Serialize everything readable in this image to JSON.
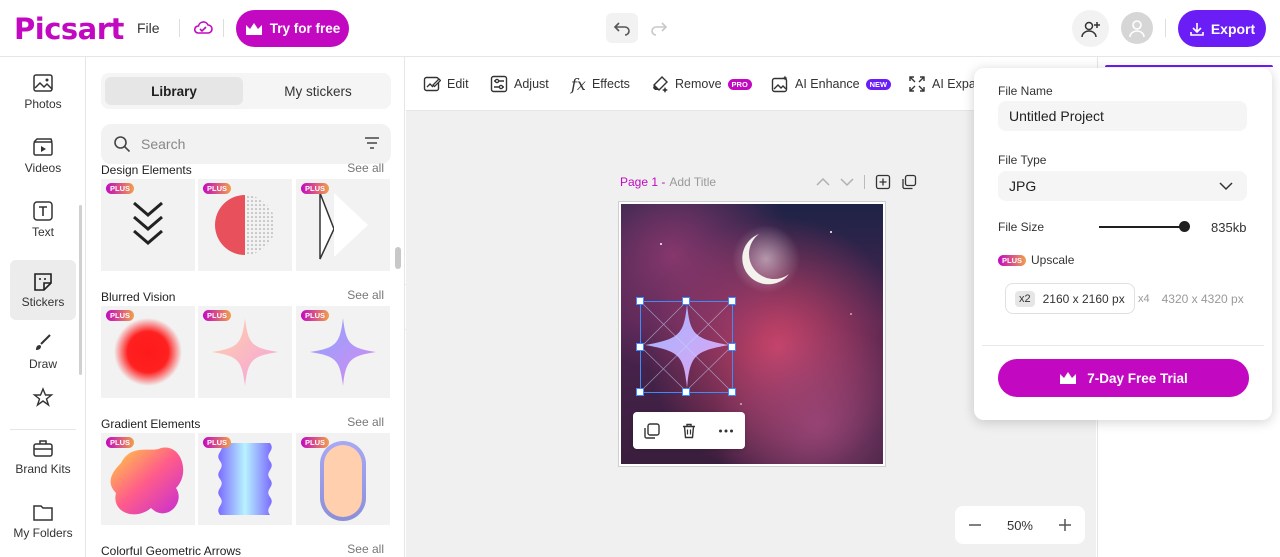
{
  "header": {
    "logo": "Picsart",
    "file_menu": "File",
    "try_label": "Try for free",
    "export_label": "Export"
  },
  "leftnav": {
    "items": [
      {
        "label": "Photos",
        "icon": "photo-icon"
      },
      {
        "label": "Videos",
        "icon": "video-icon"
      },
      {
        "label": "Text",
        "icon": "text-icon"
      },
      {
        "label": "Stickers",
        "icon": "sticker-icon"
      },
      {
        "label": "Draw",
        "icon": "brush-icon"
      },
      {
        "label": "Brand Kits",
        "icon": "briefcase-icon"
      },
      {
        "label": "My Folders",
        "icon": "folder-icon"
      }
    ]
  },
  "panel": {
    "tabs": [
      "Library",
      "My stickers"
    ],
    "active_tab": "Library",
    "search_placeholder": "Search",
    "badge": "PLUS",
    "see_all": "See all",
    "sections": [
      "Design Elements",
      "Blurred Vision",
      "Gradient Elements",
      "Colorful Geometric Arrows"
    ]
  },
  "toolbar": {
    "items": [
      {
        "label": "Edit",
        "icon": "edit-icon"
      },
      {
        "label": "Adjust",
        "icon": "adjust-icon"
      },
      {
        "label": "Effects",
        "icon": "fx-icon"
      },
      {
        "label": "Remove",
        "icon": "eraser-icon",
        "badge": "PRO"
      },
      {
        "label": "AI Enhance",
        "icon": "enhance-icon",
        "badge": "NEW"
      },
      {
        "label": "AI Expand",
        "icon": "expand-icon"
      }
    ]
  },
  "canvas": {
    "page_label": "Page 1 -",
    "page_title_placeholder": "Add Title",
    "zoom": "50%"
  },
  "export_popup": {
    "file_name_label": "File Name",
    "file_name": "Untitled Project",
    "file_type_label": "File Type",
    "file_type": "JPG",
    "file_size_label": "File Size",
    "file_size_level": 1.0,
    "file_size": "835kb",
    "upscale_badge": "PLUS",
    "upscale_label": "Upscale",
    "upscale_options": [
      {
        "mult": "x2",
        "size": "2160 x 2160 px"
      },
      {
        "mult": "x4",
        "size": "4320 x 4320 px"
      }
    ],
    "trial_label": "7-Day Free Trial"
  },
  "colors": {
    "brand": "#c209c1",
    "export": "#6b1df5",
    "selection": "#3b8cff"
  }
}
